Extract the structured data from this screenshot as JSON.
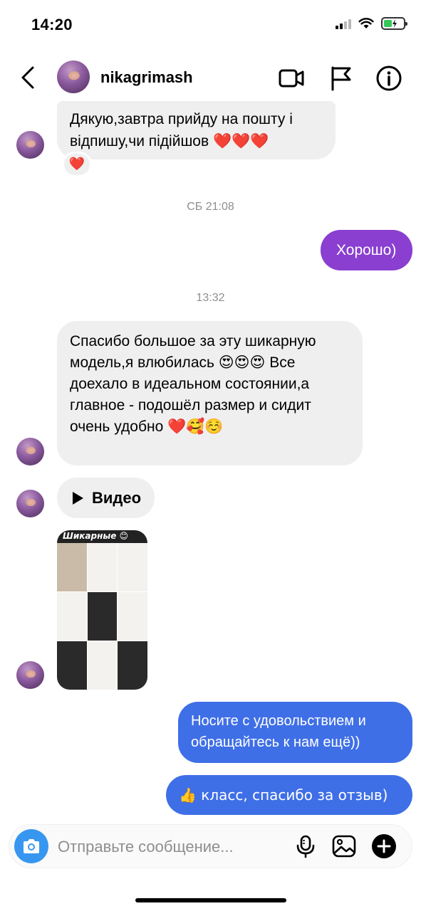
{
  "status_bar": {
    "time": "14:20"
  },
  "header": {
    "username": "nikagrimash"
  },
  "messages": {
    "m1": {
      "text": "Дякую,завтра прийду на пошту і відпишу,чи підійшов ❤️❤️❤️",
      "reaction": "❤️"
    },
    "ts1": "СБ 21:08",
    "m2": {
      "text": "Хорошо)"
    },
    "ts2": "13:32",
    "m3": {
      "text": "Спасибо большое за эту шикарную модель,я влюбилась 😍😍😍 Все доехало в идеальном состоянии,а главное - подошёл размер и сидит очень удобно ❤️🥰☺️"
    },
    "m4": {
      "label": "Видео"
    },
    "m5": {
      "thumb_title": "Шикарные 😊"
    },
    "m6": {
      "text": "Носите с удовольствием и обращайтесь к нам ещё))"
    },
    "m7": {
      "text": "👍 класс, спасибо за отзыв)"
    }
  },
  "composer": {
    "placeholder": "Отправьте сообщение..."
  },
  "colors": {
    "incoming_bubble": "#efefef",
    "outgoing_purple": "#8a3fd1",
    "outgoing_blue": "#3f6fe6",
    "camera_button": "#3797f0",
    "timestamp_text": "#8e8e8e"
  },
  "icons": {
    "back": "chevron-left-icon",
    "video_call": "video-camera-icon",
    "report": "flag-icon",
    "info": "info-icon",
    "camera": "camera-icon",
    "microphone": "microphone-icon",
    "gallery": "image-icon",
    "add": "plus-circle-icon"
  }
}
